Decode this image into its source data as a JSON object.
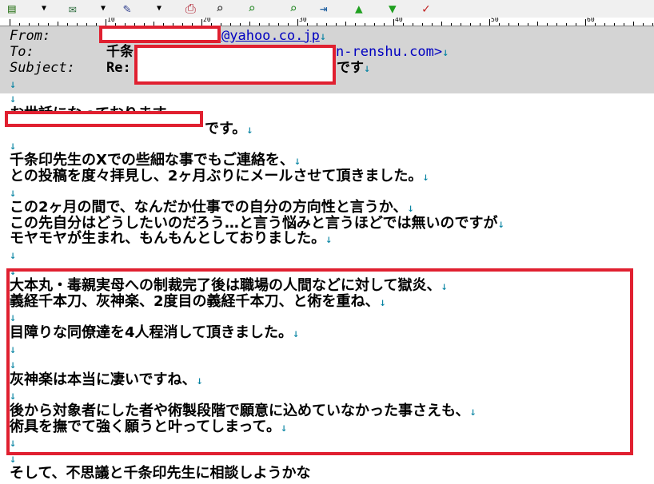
{
  "toolbar": {
    "buttons": [
      {
        "name": "mailbox-icon",
        "glyph": "▤"
      },
      {
        "name": "dropdown-1",
        "glyph": "▼"
      },
      {
        "name": "compose-icon",
        "glyph": "✉"
      },
      {
        "name": "dropdown-2",
        "glyph": "▼"
      },
      {
        "name": "reply-icon",
        "glyph": "✎"
      },
      {
        "name": "dropdown-3",
        "glyph": "▼"
      },
      {
        "name": "print-icon",
        "glyph": "⎙"
      },
      {
        "name": "search-icon",
        "glyph": "⌕"
      },
      {
        "name": "find-next-icon",
        "glyph": "⌕"
      },
      {
        "name": "find-prev-icon",
        "glyph": "⌕"
      },
      {
        "name": "move-icon",
        "glyph": "⇥"
      },
      {
        "name": "up-icon",
        "glyph": "▲"
      },
      {
        "name": "down-icon",
        "glyph": "▼"
      },
      {
        "name": "check-icon",
        "glyph": "✓"
      }
    ]
  },
  "ruler": {
    "ticks": [
      "10",
      "20",
      "30",
      "40",
      "50",
      "60"
    ]
  },
  "header": {
    "from_label": "From:",
    "from_domain": "@yahoo.co.jp",
    "to_label": "To:",
    "to_prefix": "千条",
    "to_suffix": "n-renshu.com>",
    "subject_label": "Subject:",
    "subject_prefix": "Re:",
    "subject_suffix": "です",
    "lf": "↓"
  },
  "body": {
    "lines": [
      "",
      "お世話になっております。",
      "です。",
      "",
      "千条印先生のXでの些細な事でもご連絡を、",
      "との投稿を度々拝見し、2ヶ月ぶりにメールさせて頂きました。",
      "",
      "この2ヶ月の間で、なんだか仕事での自分の方向性と言うか、",
      "この先自分はどうしたいのだろう…と言う悩みと言うほどでは無いのですが",
      "モヤモヤが生まれ、もんもんとしておりました。",
      "",
      "",
      "大本丸・毒親実母への制裁完了後は職場の人間などに対して獄炎、",
      "義経千本刀、灰神楽、2度目の義経千本刀、と術を重ね、",
      "",
      "目障りな同僚達を4人程消して頂きました。",
      "",
      "",
      "灰神楽は本当に凄いですね、",
      "",
      "後から対象者にした者や術製段階で願意に込めていなかった事さえも、",
      "術具を撫でて強く願うと叶ってしまって。",
      "",
      "",
      "そして、不思議と千条印先生に相談しようかな"
    ],
    "lf": "↓"
  }
}
